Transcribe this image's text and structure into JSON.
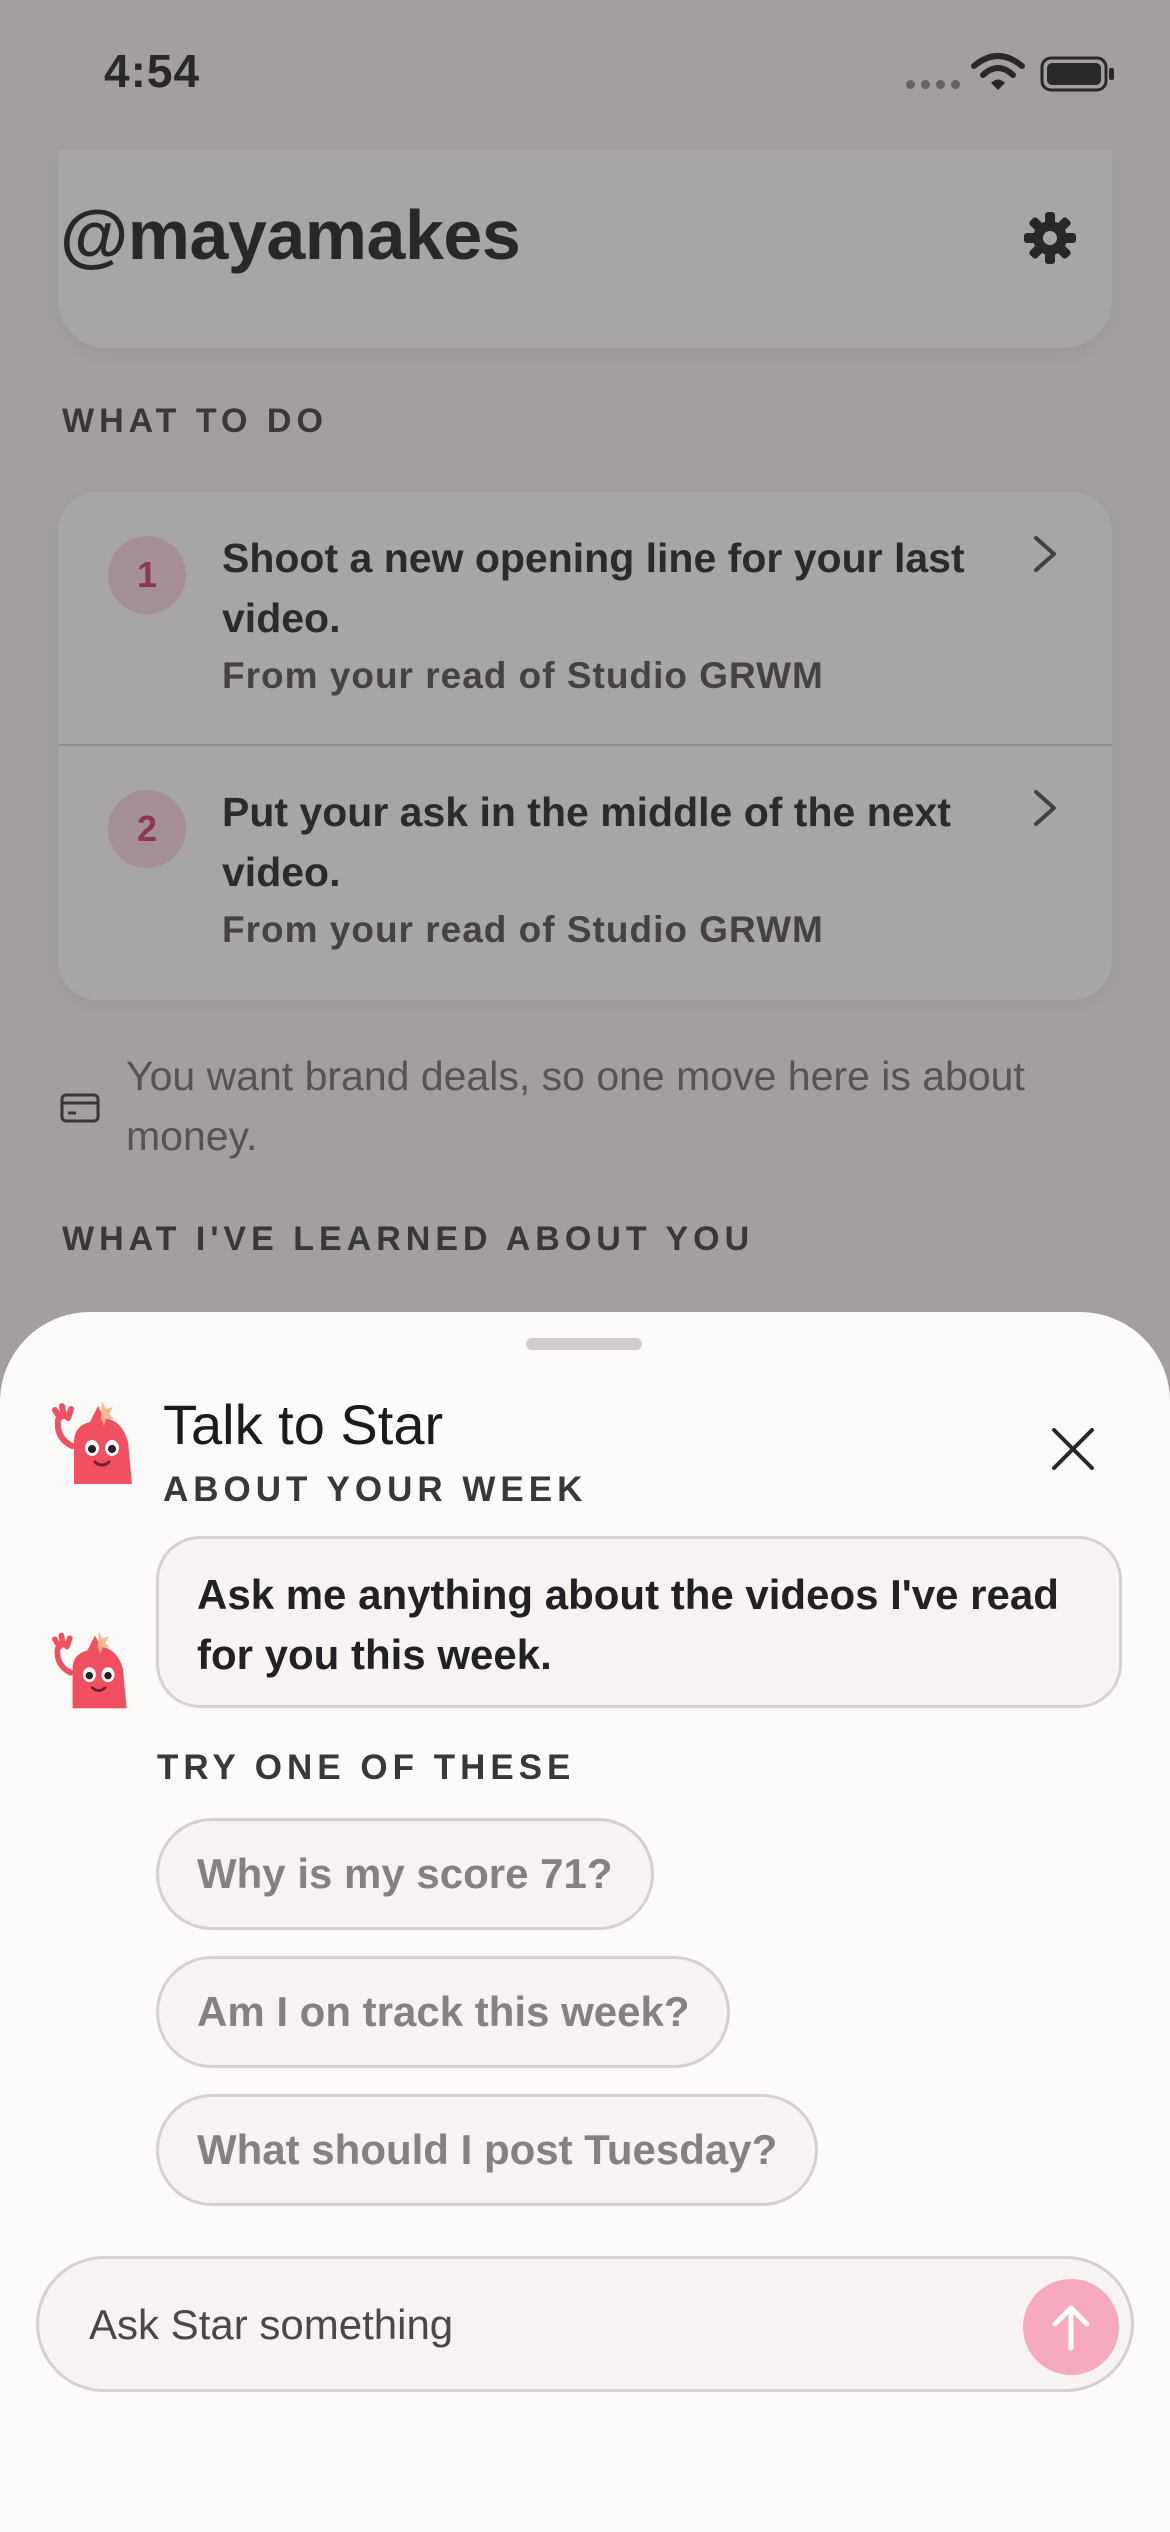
{
  "status_bar": {
    "time": "4:54",
    "icons": [
      "cellular-signal-icon",
      "wifi-icon",
      "battery-icon"
    ]
  },
  "header": {
    "handle": "@mayamakes",
    "settings_icon": "gear-icon"
  },
  "what_to_do": {
    "label": "WHAT TO DO",
    "items": [
      {
        "number": "1",
        "title": "Shoot a new opening line for your last video.",
        "source": "From your read of Studio GRWM"
      },
      {
        "number": "2",
        "title": "Put your ask in the middle of the next video.",
        "source": "From your read of Studio GRWM"
      }
    ]
  },
  "money_note": {
    "icon": "credit-card-icon",
    "text": "You want brand deals, so one move here is about money."
  },
  "learned": {
    "label": "WHAT I'VE LEARNED ABOUT YOU"
  },
  "sheet": {
    "title": "Talk to Star",
    "subtitle": "ABOUT YOUR WEEK",
    "message": "Ask me anything about the videos I've read for you this week.",
    "suggestions_label": "TRY ONE OF THESE",
    "suggestions": [
      "Why is my score 71?",
      "Am I on track this week?",
      "What should I post Tuesday?"
    ],
    "input_placeholder": "Ask Star something"
  },
  "colors": {
    "accent_pink": "#f7a9bf",
    "number_badge_bg": "#f7d8df",
    "number_badge_text": "#c93d64",
    "mascot_red": "#f0505f"
  }
}
